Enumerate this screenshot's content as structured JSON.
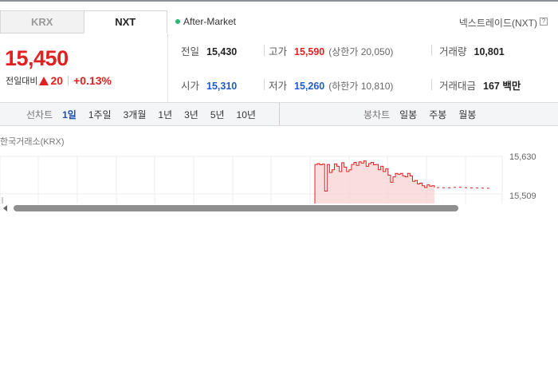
{
  "tabs": [
    {
      "label": "KRX",
      "active": false
    },
    {
      "label": "NXT",
      "active": true
    }
  ],
  "market_status": "After-Market",
  "right_link": "넥스트레이드(NXT)",
  "help_icon": "?",
  "price": {
    "current": "15,450",
    "change_label": "전일대비",
    "change_value": "20",
    "change_pct": "+0.13%"
  },
  "stats": {
    "prev_close": {
      "label": "전일",
      "value": "15,430"
    },
    "high": {
      "label": "고가",
      "value": "15,590",
      "sub": "(상한가 20,050)"
    },
    "volume": {
      "label": "거래량",
      "value": "10,801"
    },
    "open": {
      "label": "시가",
      "value": "15,310"
    },
    "low": {
      "label": "저가",
      "value": "15,260",
      "sub": "(하한가 10,810)"
    },
    "amount": {
      "label": "거래대금",
      "value": "167 백만"
    }
  },
  "toolbar": {
    "line_label": "선차트",
    "line_items": [
      "1일",
      "1주일",
      "3개월",
      "1년",
      "3년",
      "5년",
      "10년"
    ],
    "line_active_index": 0,
    "candle_label": "봉차트",
    "candle_items": [
      "일봉",
      "주봉",
      "월봉"
    ]
  },
  "chart_data": {
    "type": "area",
    "caption": "한국거래소(KRX)",
    "y_ticks": [
      "15,630",
      "15,509"
    ],
    "ylim": [
      15380,
      15650
    ],
    "series": [
      {
        "values": [
          15600,
          15605,
          15598,
          15602,
          15450,
          15600,
          15555,
          15570,
          15603,
          15590,
          15560,
          15610,
          15585,
          15560,
          15570,
          15600,
          15612,
          15595,
          15615,
          15608,
          15620,
          15590,
          15605,
          15612,
          15598,
          15600,
          15570,
          15590,
          15560,
          15575,
          15540,
          15500,
          15530,
          15550,
          15545,
          15550,
          15535,
          15530,
          15550,
          15535,
          15505,
          15510,
          15490,
          15495,
          15480,
          15470,
          15485,
          15478,
          15480,
          15470
        ]
      }
    ],
    "colors": {
      "line": "#e12121",
      "fill": "#f9d6d6"
    }
  }
}
